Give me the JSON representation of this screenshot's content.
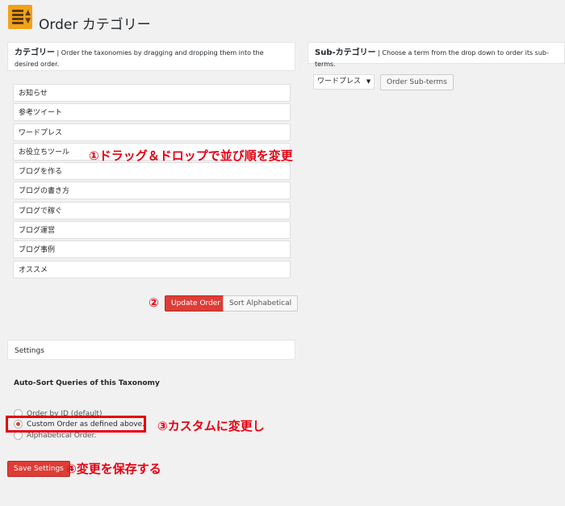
{
  "header": {
    "title": "Order カテゴリー"
  },
  "category_panel": {
    "title": "カテゴリー",
    "separator": " | ",
    "description": "Order the taxonomies by dragging and dropping them into the desired order."
  },
  "sub_panel": {
    "title": "Sub-カテゴリー",
    "separator": " | ",
    "description": "Choose a term from the drop down to order its sub-terms.",
    "select_value": "ワードプレス",
    "order_button": "Order Sub-terms"
  },
  "terms": [
    "お知らせ",
    "参考ツイート",
    "ワードプレス",
    "お役立ちツール",
    "ブログを作る",
    "ブログの書き方",
    "ブログで稼ぐ",
    "ブログ運営",
    "ブログ事例",
    "オススメ"
  ],
  "buttons": {
    "update_order": "Update Order",
    "sort_alpha": "Sort Alphabetical",
    "save_settings": "Save Settings"
  },
  "settings": {
    "title": "Settings",
    "subtitle": "Auto-Sort Queries of this Taxonomy",
    "options": [
      "Order by ID (default)",
      "Custom Order as defined above.",
      "Alphabetical Order."
    ],
    "selected_index": 1
  },
  "annotations": {
    "a1": "①ドラッグ＆ドロップで並び順を変更",
    "a2": "②",
    "a3": "③カスタムに変更し",
    "a4": "④変更を保存する"
  },
  "colors": {
    "accent_red": "#e60012",
    "button_red": "#dd3d36",
    "icon_orange": "#f2a21a"
  }
}
